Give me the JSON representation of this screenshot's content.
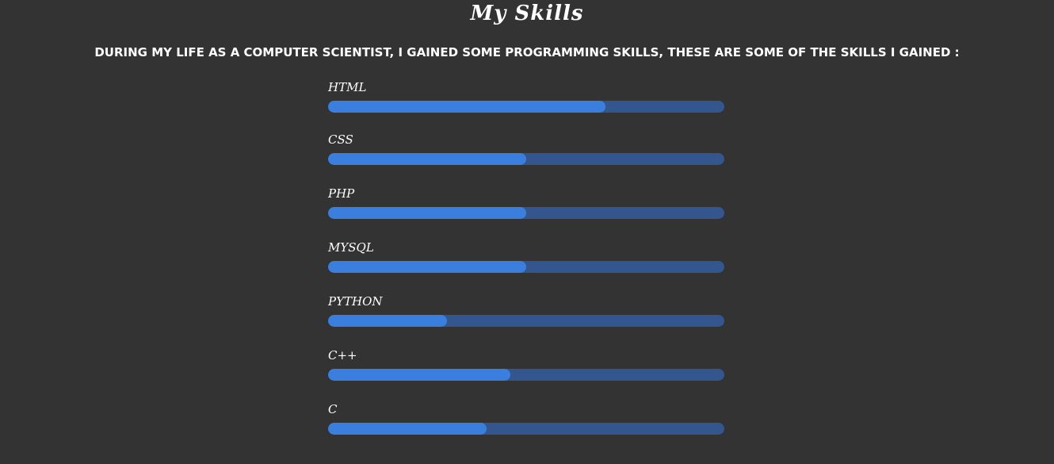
{
  "header": {
    "title": "My Skills",
    "intro": "DURING MY LIFE AS A COMPUTER SCIENTIST, I GAINED SOME PROGRAMMING SKILLS, THESE ARE SOME OF THE SKILLS I GAINED :"
  },
  "colors": {
    "background": "#333333",
    "bar_track": "#34568f",
    "bar_fill": "#3a7fdd",
    "text": "#ffffff"
  },
  "skills": [
    {
      "label": "HTML",
      "level_percent": 70
    },
    {
      "label": "CSS",
      "level_percent": 50
    },
    {
      "label": "PHP",
      "level_percent": 50
    },
    {
      "label": "MYSQL",
      "level_percent": 50
    },
    {
      "label": "PYTHON",
      "level_percent": 30
    },
    {
      "label": "C++",
      "level_percent": 46
    },
    {
      "label": "C",
      "level_percent": 40
    }
  ]
}
